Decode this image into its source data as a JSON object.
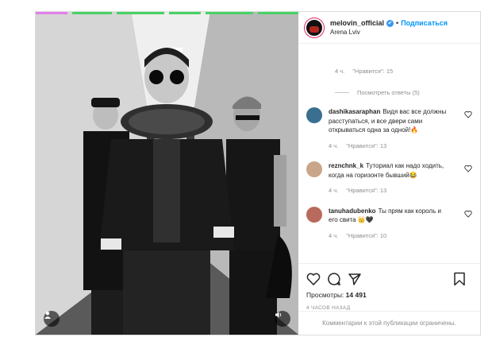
{
  "header": {
    "username": "melovin_official",
    "follow_label": "Подписаться",
    "dot": "•",
    "location": "Arena Lviv",
    "verified_icon": "✔"
  },
  "thread": {
    "prev_meta": {
      "time": "4 ч.",
      "likes": "\"Нравится\": 15"
    },
    "view_replies": "Посмотреть ответы (5)"
  },
  "comments": [
    {
      "user": "dashikasaraphan",
      "text": "Видя вас все должны расступаться, и все двери сами открываться одна за одной!🔥",
      "time": "4 ч.",
      "likes": "\"Нравится\": 13",
      "avatar_color": "#3a6f8f"
    },
    {
      "user": "reznchnk_k",
      "text": "Туториал как надо ходить, когда на горизонте бывший😂",
      "time": "4 ч.",
      "likes": "\"Нравится\": 13",
      "avatar_color": "#c9a58a"
    },
    {
      "user": "tanuhadubenko",
      "text": "Ты прям как король и его свита 👑🖤",
      "time": "4 ч.",
      "likes": "\"Нравится\": 10",
      "avatar_color": "#b86a5c"
    }
  ],
  "actions": {
    "views_label": "Просмотры:",
    "views_count": "14 491",
    "posted": "4 ЧАСОВ НАЗАД",
    "comments_disabled": "Комментарии к этой публикации ограничены."
  },
  "progress": {
    "segments": 6,
    "completed_fraction": 0.17
  },
  "icons": [
    "heart-icon",
    "comment-icon",
    "share-icon",
    "bookmark-icon",
    "user-icon",
    "sound-icon",
    "verified-icon"
  ]
}
